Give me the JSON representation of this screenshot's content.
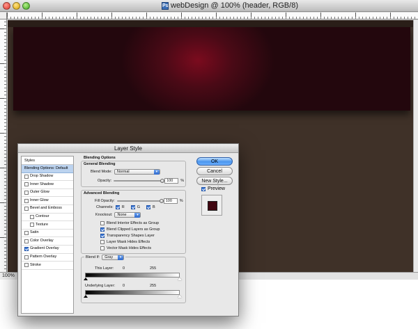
{
  "window": {
    "title": "webDesign @ 100% (header, RGB/8)",
    "zoom": "100%"
  },
  "dialog": {
    "title": "Layer Style",
    "styles_header": "Styles",
    "styles": [
      {
        "label": "Blending Options: Default",
        "selected": true,
        "checkbox": false,
        "checked": false,
        "indent": false
      },
      {
        "label": "Drop Shadow",
        "checkbox": true,
        "checked": false,
        "indent": false
      },
      {
        "label": "Inner Shadow",
        "checkbox": true,
        "checked": false,
        "indent": false
      },
      {
        "label": "Outer Glow",
        "checkbox": true,
        "checked": false,
        "indent": false
      },
      {
        "label": "Inner Glow",
        "checkbox": true,
        "checked": false,
        "indent": false
      },
      {
        "label": "Bevel and Emboss",
        "checkbox": true,
        "checked": false,
        "indent": false
      },
      {
        "label": "Contour",
        "checkbox": true,
        "checked": false,
        "indent": true
      },
      {
        "label": "Texture",
        "checkbox": true,
        "checked": false,
        "indent": true
      },
      {
        "label": "Satin",
        "checkbox": true,
        "checked": false,
        "indent": false
      },
      {
        "label": "Color Overlay",
        "checkbox": true,
        "checked": false,
        "indent": false
      },
      {
        "label": "Gradient Overlay",
        "checkbox": true,
        "checked": true,
        "indent": false
      },
      {
        "label": "Pattern Overlay",
        "checkbox": true,
        "checked": false,
        "indent": false
      },
      {
        "label": "Stroke",
        "checkbox": true,
        "checked": false,
        "indent": false
      }
    ],
    "blending_options": {
      "title": "Blending Options",
      "general_title": "General Blending",
      "blend_mode_label": "Blend Mode:",
      "blend_mode_value": "Normal",
      "opacity_label": "Opacity:",
      "opacity_value": "100",
      "opacity_level": 1.0,
      "percent": "%"
    },
    "advanced": {
      "title": "Advanced Blending",
      "fill_opacity_label": "Fill Opacity:",
      "fill_opacity_value": "100",
      "fill_opacity_level": 1.0,
      "percent": "%",
      "channels_label": "Channels:",
      "channel_r": "R",
      "channel_g": "G",
      "channel_b": "B",
      "knockout_label": "Knockout:",
      "knockout_value": "None",
      "options": [
        {
          "label": "Blend Interior Effects as Group",
          "checked": false
        },
        {
          "label": "Blend Clipped Layers as Group",
          "checked": true
        },
        {
          "label": "Transparency Shapes Layer",
          "checked": true
        },
        {
          "label": "Layer Mask Hides Effects",
          "checked": false
        },
        {
          "label": "Vector Mask Hides Effects",
          "checked": false
        }
      ]
    },
    "blend_if": {
      "label": "Blend If:",
      "value": "Gray",
      "this_layer_label": "This Layer:",
      "this_low": "0",
      "this_high": "255",
      "underlying_label": "Underlying Layer:",
      "under_low": "0",
      "under_high": "255"
    },
    "buttons": {
      "ok": "OK",
      "cancel": "Cancel",
      "new_style": "New Style..."
    },
    "preview_label": "Preview",
    "preview_checked": true,
    "preview_color": "#400610"
  },
  "colors": {
    "canvas_bg": "#3f3128",
    "header_center": "#7b0b1e",
    "header_edge": "#23070d"
  }
}
